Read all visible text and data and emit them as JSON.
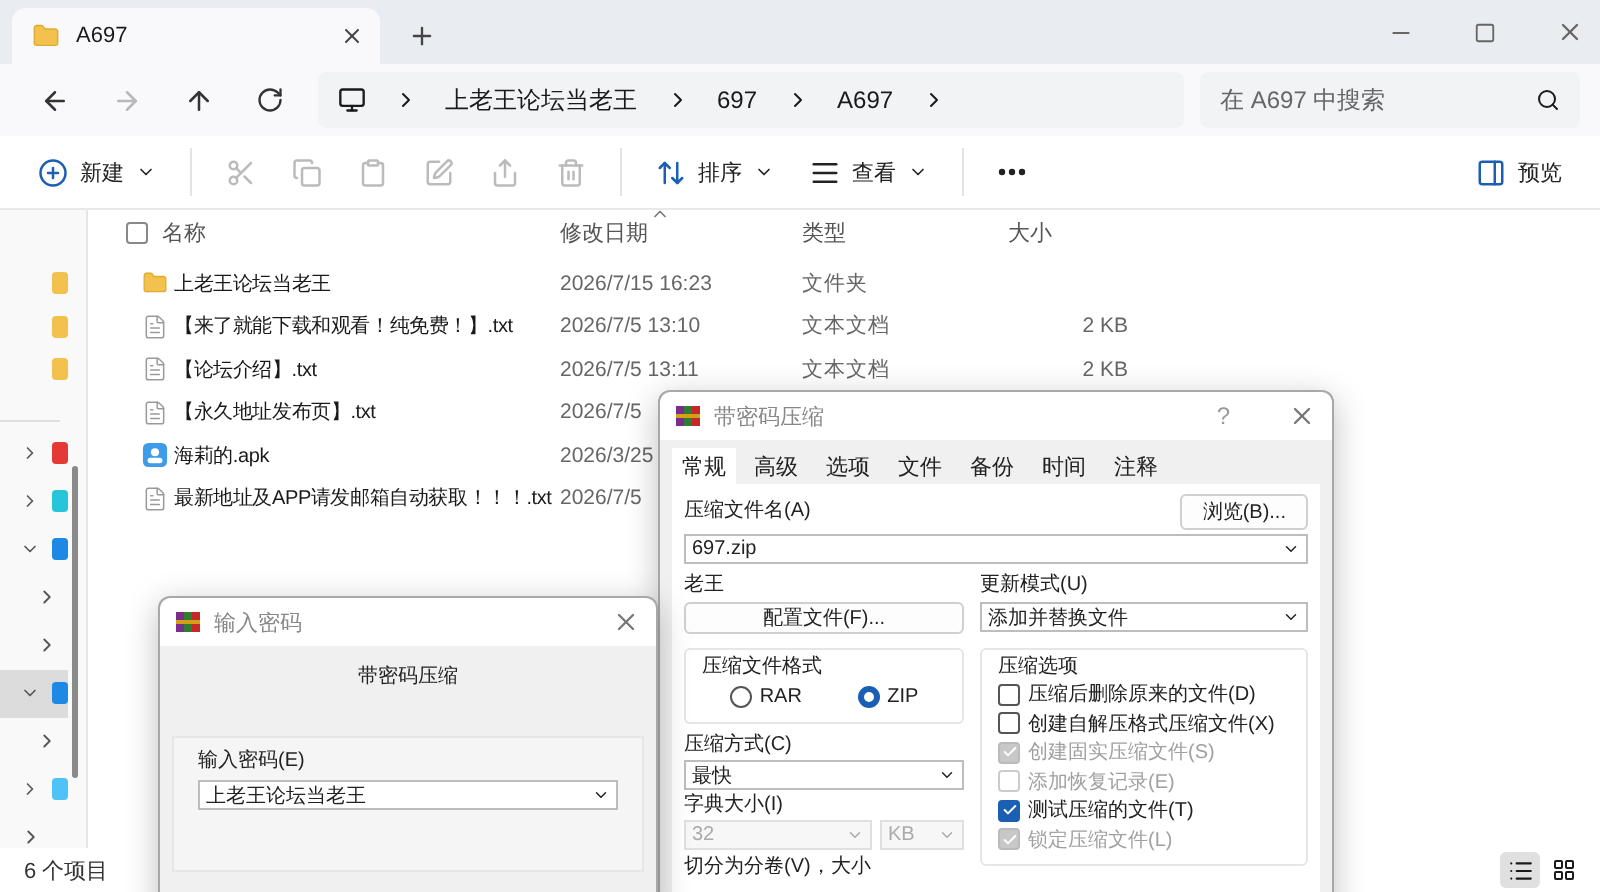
{
  "window": {
    "tab_title": "A697"
  },
  "nav": {
    "breadcrumb": [
      "上老王论坛当老王",
      "697",
      "A697"
    ],
    "search": {
      "placeholder": "在 A697 中搜索"
    }
  },
  "toolbar": {
    "new": "新建",
    "sort": "排序",
    "view": "查看",
    "preview": "预览"
  },
  "sidebar": {
    "pinned": [
      {
        "color": "#f2c14e"
      },
      {
        "color": "#f2c14e"
      },
      {
        "color": "#f2c14e"
      }
    ],
    "tree": [
      {
        "expanded": false,
        "selected": false,
        "color": "#e53935"
      },
      {
        "expanded": false,
        "selected": false,
        "color": "#26c6da"
      },
      {
        "expanded": true,
        "selected": false,
        "color": "#1e88e5",
        "children": [
          {
            "expanded": false,
            "selected": false
          },
          {
            "expanded": false,
            "selected": false
          }
        ]
      },
      {
        "expanded": true,
        "selected": true,
        "color": "#1e88e5",
        "children": [
          {
            "expanded": false,
            "selected": false
          }
        ]
      },
      {
        "expanded": false,
        "selected": false,
        "color": "#4fc3f7"
      },
      {
        "expanded": false,
        "selected": false
      }
    ]
  },
  "table": {
    "select_all": {
      "checked": false
    },
    "columns": [
      "名称",
      "修改日期",
      "类型",
      "大小"
    ],
    "rows": [
      {
        "kind": "folder",
        "name": "上老王论坛当老王",
        "date": "2026/7/15 16:23",
        "type": "文件夹"
      },
      {
        "kind": "text",
        "name": "【来了就能下载和观看！纯免费！】.txt",
        "date": "2026/7/5 13:10",
        "type": "文本文档",
        "size": "2 KB"
      },
      {
        "kind": "text",
        "name": "【论坛介绍】.txt",
        "date": "2026/7/5 13:11",
        "type": "文本文档",
        "size": "2 KB"
      },
      {
        "kind": "text",
        "name": "【永久地址发布页】.txt",
        "date": "2026/7/5"
      },
      {
        "kind": "apk",
        "name": "海莉的.apk",
        "date": "2026/3/25"
      },
      {
        "kind": "text",
        "name": "最新地址及APP请发邮箱自动获取！！！.txt",
        "date": "2026/7/5"
      }
    ]
  },
  "status_bar": {
    "count": "6 个项目"
  },
  "archive_dialog": {
    "title": "带密码压缩",
    "help": "?",
    "tabs": [
      {
        "label": "常规",
        "selected": true
      },
      {
        "label": "高级",
        "selected": false
      },
      {
        "label": "选项",
        "selected": false
      },
      {
        "label": "文件",
        "selected": false
      },
      {
        "label": "备份",
        "selected": false
      },
      {
        "label": "时间",
        "selected": false
      },
      {
        "label": "注释",
        "selected": false
      }
    ],
    "archive_name_label": "压缩文件名(A)",
    "archive_name": "697.zip",
    "browse": "浏览(B)...",
    "profile_label": "老王",
    "profile_button": "配置文件(F)...",
    "update_mode_label": "更新模式(U)",
    "update_mode": "添加并替换文件",
    "format": {
      "label": "压缩文件格式",
      "options": [
        {
          "label": "RAR",
          "selected": false
        },
        {
          "label": "ZIP",
          "selected": true
        }
      ]
    },
    "method_label": "压缩方式(C)",
    "method": "最快",
    "dict_label": "字典大小(I)",
    "dict_size": "32",
    "dict_unit": "KB",
    "split_label": "切分为分卷(V)，大小",
    "options": {
      "label": "压缩选项",
      "items": [
        {
          "label": "压缩后删除原来的文件(D)",
          "checked": false,
          "disabled": false
        },
        {
          "label": "创建自解压格式压缩文件(X)",
          "checked": false,
          "disabled": false
        },
        {
          "label": "创建固实压缩文件(S)",
          "checked": true,
          "disabled": true
        },
        {
          "label": "添加恢复记录(E)",
          "checked": false,
          "disabled": true
        },
        {
          "label": "测试压缩的文件(T)",
          "checked": true,
          "disabled": false
        },
        {
          "label": "锁定压缩文件(L)",
          "checked": true,
          "disabled": true
        }
      ]
    }
  },
  "password_dialog": {
    "title": "输入密码",
    "heading": "带密码压缩",
    "label": "输入密码(E)",
    "value": "上老王论坛当老王"
  }
}
